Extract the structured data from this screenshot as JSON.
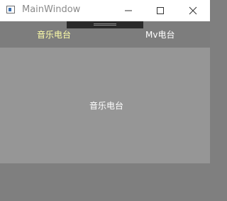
{
  "window": {
    "title": "MainWindow",
    "icons": {
      "app": "app-window-icon",
      "minimize": "minimize-icon",
      "maximize": "maximize-icon",
      "close": "close-icon"
    }
  },
  "tabs": [
    {
      "label": "音乐电台",
      "selected": true
    },
    {
      "label": "Mv电台",
      "selected": false
    }
  ],
  "content": {
    "label": "音乐电台"
  },
  "colors": {
    "tab_selected_text": "#ffffaa",
    "tab_text": "#ffffff",
    "tabbar_bg": "#7d7d7d",
    "content_bg": "#969696",
    "bottom_bg": "#7f7f7f"
  }
}
